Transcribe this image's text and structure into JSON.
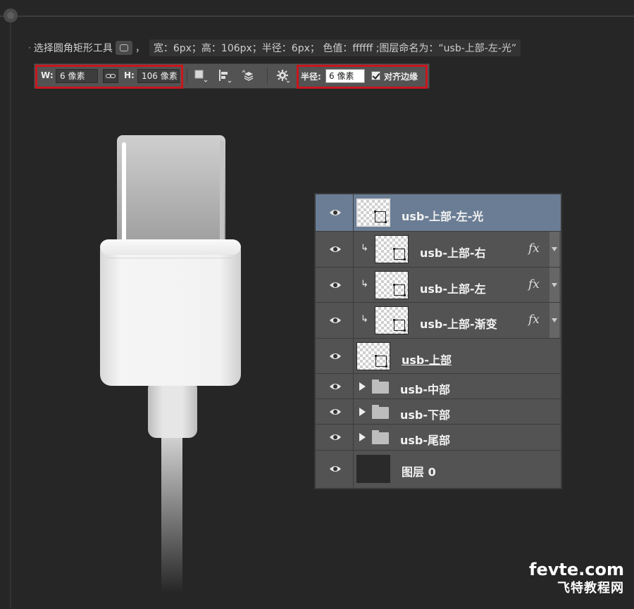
{
  "instruction": {
    "bullet": "·",
    "prefix": "选择圆角矩形工具",
    "comma": "，",
    "spec": "宽：6px；高：106px；半径：6px； 色值：ffffff ;图层命名为：“usb-上部-左-光”"
  },
  "options_bar": {
    "w_label": "W:",
    "w_value": "6 像素",
    "h_label": "H:",
    "h_value": "106 像素",
    "radius_label": "半径:",
    "radius_value": "6 像素",
    "align_edges_label": "对齐边缘",
    "align_edges_checked": true
  },
  "layers": [
    {
      "name": "usb-上部-左-光",
      "selected": true,
      "clipped": false,
      "fx": false,
      "type": "shape"
    },
    {
      "name": "usb-上部-右",
      "selected": false,
      "clipped": true,
      "fx": true,
      "type": "shape"
    },
    {
      "name": "usb-上部-左",
      "selected": false,
      "clipped": true,
      "fx": true,
      "type": "shape"
    },
    {
      "name": "usb-上部-渐变",
      "selected": false,
      "clipped": true,
      "fx": true,
      "type": "shape"
    },
    {
      "name": "usb-上部",
      "selected": false,
      "clipped": false,
      "fx": false,
      "type": "shape"
    },
    {
      "name": "usb-中部",
      "type": "group"
    },
    {
      "name": "usb-下部",
      "type": "group"
    },
    {
      "name": "usb-尾部",
      "type": "group"
    },
    {
      "name": "图层 0",
      "type": "background"
    }
  ],
  "fx_label": "fx",
  "watermark": {
    "top": "fevte.com",
    "bottom": "飞特教程网"
  },
  "colors": {
    "background": "#262626",
    "panel": "#535353",
    "selected_layer": "#6a7d94",
    "highlight_box": "#c8161d"
  }
}
